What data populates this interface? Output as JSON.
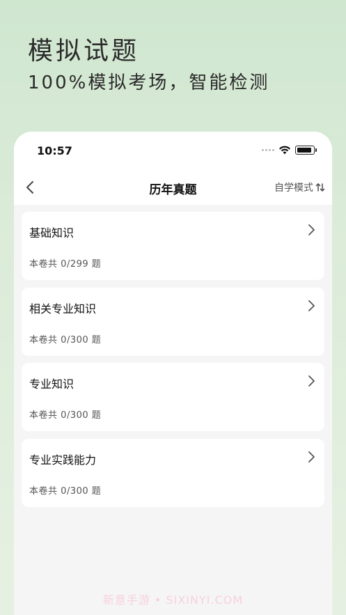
{
  "promo": {
    "title": "模拟试题",
    "subtitle": "100%模拟考场，智能检测"
  },
  "status_bar": {
    "time": "10:57"
  },
  "nav": {
    "title": "历年真题",
    "mode_label": "自学模式"
  },
  "papers": [
    {
      "title": "基础知识",
      "prefix": "本卷共",
      "done": "0",
      "total": "299",
      "unit": "题"
    },
    {
      "title": "相关专业知识",
      "prefix": "本卷共",
      "done": "0",
      "total": "300",
      "unit": "题"
    },
    {
      "title": "专业知识",
      "prefix": "本卷共",
      "done": "0",
      "total": "300",
      "unit": "题"
    },
    {
      "title": "专业实践能力",
      "prefix": "本卷共",
      "done": "0",
      "total": "300",
      "unit": "题"
    }
  ],
  "watermark": "新意手游 • SIXINYI.COM",
  "colors": {
    "background_top": "#cfe6cf",
    "card": "#ffffff",
    "list_bg": "#f5f5f5"
  }
}
